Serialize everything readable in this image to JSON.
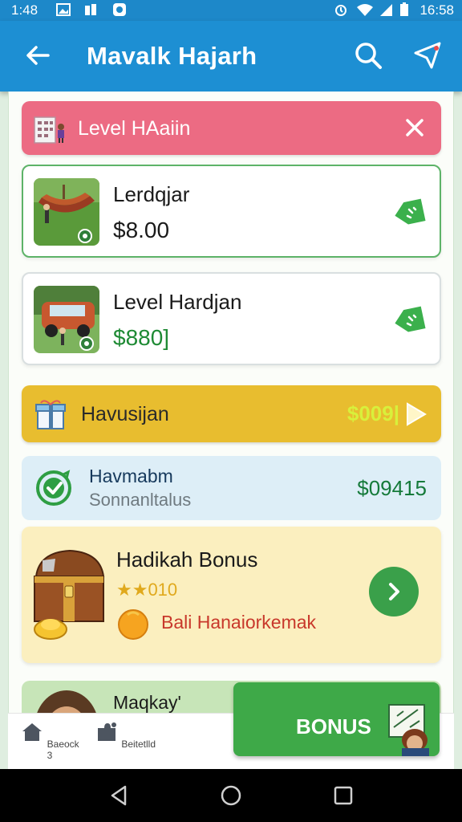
{
  "status": {
    "time_left": "1:48",
    "time_right": "16:58",
    "icons": [
      "image-icon",
      "notification-icon",
      "app-icon",
      "alarm-icon",
      "wifi-icon",
      "signal-icon",
      "battery-icon"
    ]
  },
  "appbar": {
    "title": "Mavalk Hajarh",
    "back_icon": "arrow-left-icon",
    "search_icon": "search-icon",
    "action_icon": "send-icon"
  },
  "level_banner": {
    "label": "Level HAaiin",
    "close_icon": "close-icon",
    "color": "#ec6b83"
  },
  "items": [
    {
      "name": "Lerdqjar",
      "price": "$8.00",
      "price_color": "#1a1a1a",
      "tag_icon": "tag-icon"
    },
    {
      "name": "Level Hardjan",
      "price": "$880]",
      "price_color": "#1e8a34",
      "tag_icon": "tag-icon"
    }
  ],
  "gold_banner": {
    "label": "Havusijan",
    "amount": "$009|",
    "color": "#e8bd2f"
  },
  "blue_banner": {
    "title": "Havmabm",
    "subtitle": "Sonnanltalus",
    "amount": "$09415"
  },
  "bonus_card": {
    "title": "Hadikah Bonus",
    "stars": "★★010",
    "description": "Bali Hanaiorkemak"
  },
  "green_strip": {
    "label": "Maqkay'"
  },
  "bottom_nav": [
    {
      "label": "Baeock 3",
      "icon": "home-icon"
    },
    {
      "label": "Beitetlld",
      "icon": "puzzle-icon"
    }
  ],
  "bonus_button": {
    "label": "BONUS",
    "color": "#3ea948"
  },
  "system_nav": [
    "back-triangle-icon",
    "home-circle-icon",
    "recents-square-icon"
  ]
}
